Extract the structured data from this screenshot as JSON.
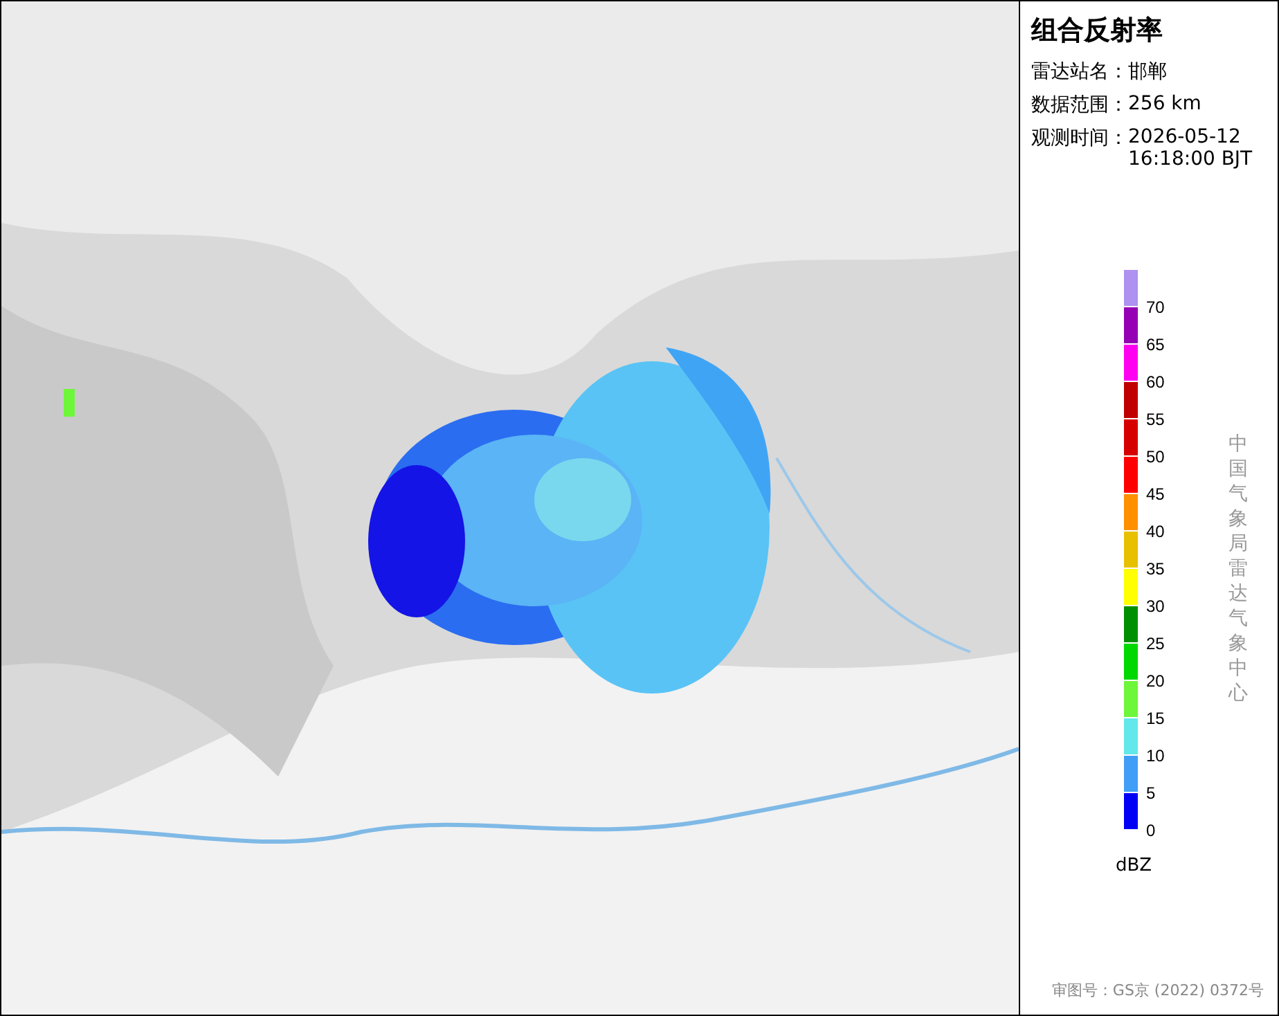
{
  "panel": {
    "title": "组合反射率",
    "info": [
      {
        "label": "雷达站名：",
        "value": "邯郸"
      },
      {
        "label": "数据范围：",
        "value": "256 km"
      },
      {
        "label": "观测时间：",
        "value": "2026-05-12 16:18:00 BJT"
      }
    ],
    "legend": {
      "items": [
        {
          "label": "70",
          "color": "#ae91f0"
        },
        {
          "label": "65",
          "color": "#9600b4"
        },
        {
          "label": "60",
          "color": "#ff00f0"
        },
        {
          "label": "55",
          "color": "#c00000"
        },
        {
          "label": "50",
          "color": "#d60000"
        },
        {
          "label": "45",
          "color": "#ff0000"
        },
        {
          "label": "40",
          "color": "#ff9000"
        },
        {
          "label": "35",
          "color": "#e7c000"
        },
        {
          "label": "30",
          "color": "#ffff00"
        },
        {
          "label": "25",
          "color": "#008f00"
        },
        {
          "label": "20",
          "color": "#00d800"
        },
        {
          "label": "15",
          "color": "#6ef63a"
        },
        {
          "label": "10",
          "color": "#62e8ea"
        },
        {
          "label": "5",
          "color": "#409ef6"
        },
        {
          "label": "0",
          "color": "#0000f6"
        }
      ],
      "unit": "dBZ"
    },
    "credit": "中国气象局雷达气象中心",
    "approval": "审图号：GS京 (2022) 0372号"
  }
}
